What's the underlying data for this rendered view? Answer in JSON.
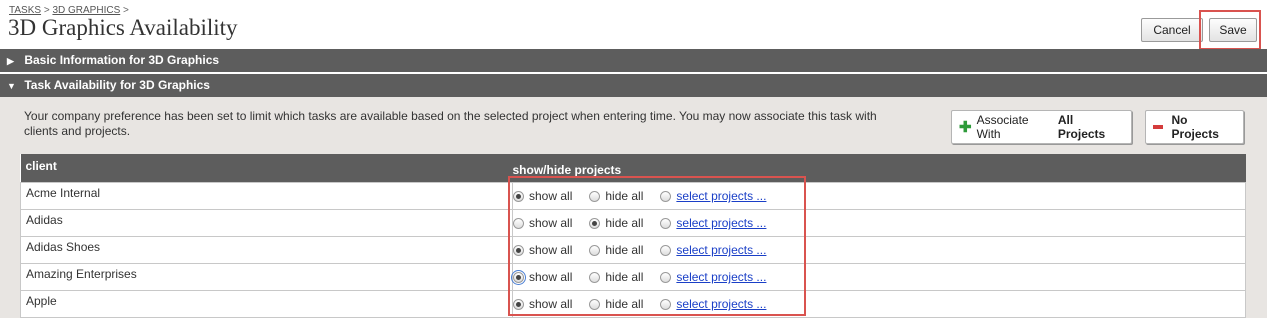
{
  "breadcrumb": {
    "item1": "TASKS",
    "sep1": ">",
    "item2": "3D GRAPHICS",
    "sep2": ">"
  },
  "page_title": "3D Graphics Availability",
  "toolbar": {
    "cancel_label": "Cancel",
    "save_label": "Save"
  },
  "sections": {
    "basic": {
      "arrow": "▶",
      "title": "Basic Information for 3D Graphics"
    },
    "availability": {
      "arrow": "▼",
      "title": "Task Availability for 3D Graphics"
    }
  },
  "description": "Your company preference has been set to limit which tasks are available based on the selected project when entering time.  You may now associate this task with clients and projects.",
  "actions": {
    "associate_prefix": "Associate With",
    "associate_bold": "All Projects",
    "no_projects": "No Projects"
  },
  "table": {
    "headers": {
      "client": "client",
      "projects": "show/hide projects"
    },
    "options": {
      "show_all": "show all",
      "hide_all": "hide all",
      "select_projects": "select projects ..."
    },
    "rows": [
      {
        "client": "Acme Internal",
        "selected": "show"
      },
      {
        "client": "Adidas",
        "selected": "hide"
      },
      {
        "client": "Adidas Shoes",
        "selected": "show"
      },
      {
        "client": "Amazing Enterprises",
        "selected": "show"
      },
      {
        "client": "Apple",
        "selected": "show"
      }
    ]
  },
  "colors": {
    "section_bar": "#5d5d5d",
    "highlight": "#d9534f",
    "link": "#1a3fc7",
    "panel_bg": "#e8e5e2"
  }
}
